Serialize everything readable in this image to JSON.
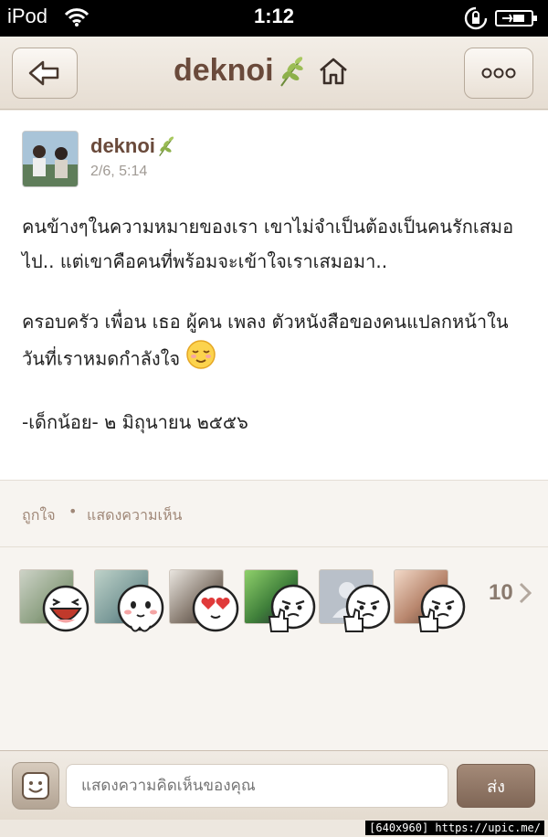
{
  "status_bar": {
    "carrier": "iPod",
    "time": "1:12"
  },
  "nav": {
    "title": "deknoi"
  },
  "post": {
    "author": "deknoi",
    "timestamp": "2/6, 5:14",
    "paragraph1": "คนข้างๆในความหมายของเรา เขาไม่จำเป็นต้องเป็นคนรักเสมอไป.. แต่เขาคือคนที่พร้อมจะเข้าใจเราเสมอมา..",
    "paragraph2": "ครอบครัว เพื่อน เธอ ผู้คน เพลง ตัวหนังสือของคนแปลกหน้าในวันที่เราหมดกำลังใจ",
    "paragraph3": "-เด็กน้อย-  ๒ มิถุนายน ๒๕๕๖"
  },
  "actions": {
    "like_label": "ถูกใจ",
    "separator": "•",
    "comment_label": "แสดงความเห็น"
  },
  "reactions": {
    "count": "10",
    "items": [
      {
        "sticker": "laughing-face-icon"
      },
      {
        "sticker": "blushing-face-icon"
      },
      {
        "sticker": "heart-eyes-face-icon"
      },
      {
        "sticker": "thumbs-up-face-icon"
      },
      {
        "sticker": "thumbs-up-face-icon"
      },
      {
        "sticker": "thumbs-up-face-icon"
      }
    ]
  },
  "bottom_bar": {
    "comment_placeholder": "แสดงความคิดเห็นของคุณ",
    "send_label": "ส่ง"
  },
  "watermark": "[640x960] https://upic.me/",
  "colors": {
    "brand_brown": "#6a4a3b",
    "background": "#ede7df"
  }
}
